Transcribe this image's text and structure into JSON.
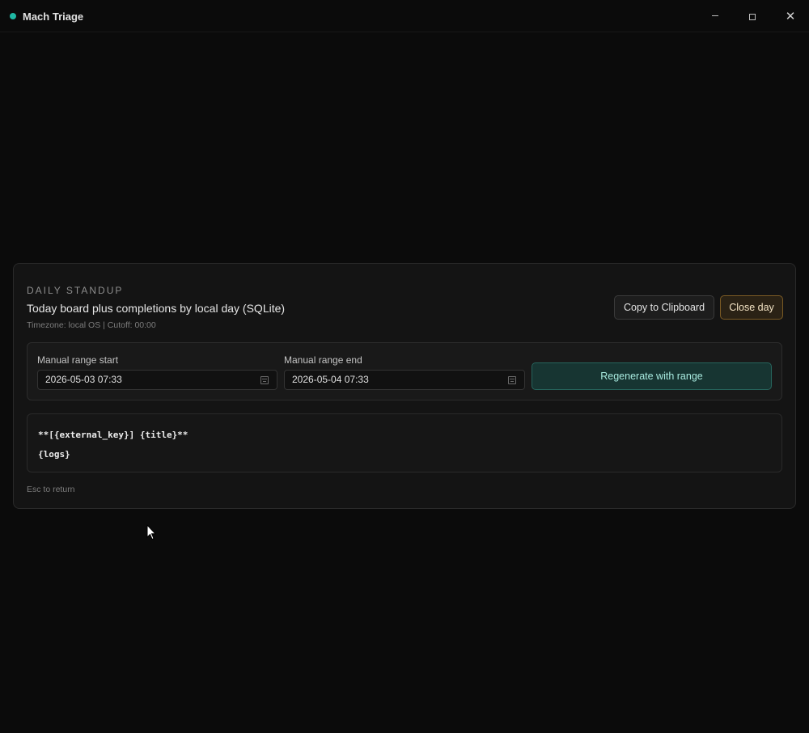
{
  "window": {
    "title": "Mach Triage",
    "accent_color": "#1fb8a4",
    "controls": {
      "minimize_icon": "minimize-icon",
      "maximize_icon": "maximize-icon",
      "close_icon": "close-icon",
      "close_glyph": "✕"
    }
  },
  "standup": {
    "eyebrow": "DAILY STANDUP",
    "heading": "Today board plus completions by local day (SQLite)",
    "subline": "Timezone: local OS | Cutoff: 00:00",
    "copy_label": "Copy to Clipboard",
    "close_day_label": "Close day",
    "range": {
      "start_label": "Manual range start",
      "start_value": "2026-05-03 07:33",
      "end_label": "Manual range end",
      "end_value": "2026-05-04 07:33",
      "regenerate_label": "Regenerate with range"
    },
    "output": {
      "line1": "**[{external_key}] {title}**",
      "line2": "{logs}"
    },
    "hint": "Esc to return"
  }
}
